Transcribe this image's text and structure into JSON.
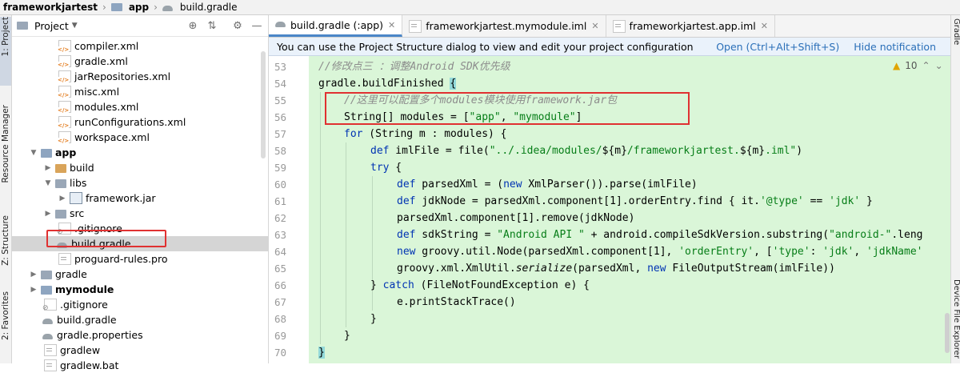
{
  "breadcrumb": [
    "frameworkjartest",
    "app",
    "build.gradle"
  ],
  "left_stripe": {
    "project_tab": "1: Project",
    "resource_tab": "Resource Manager",
    "structure_tab": "Z: Structure",
    "favorites_tab": "2: Favorites"
  },
  "project_panel": {
    "title": "Project",
    "rows": [
      {
        "label": "compiler.xml"
      },
      {
        "label": "gradle.xml"
      },
      {
        "label": "jarRepositories.xml"
      },
      {
        "label": "misc.xml"
      },
      {
        "label": "modules.xml"
      },
      {
        "label": "runConfigurations.xml"
      },
      {
        "label": "workspace.xml"
      },
      {
        "label": "app"
      },
      {
        "label": "build"
      },
      {
        "label": "libs"
      },
      {
        "label": "framework.jar"
      },
      {
        "label": "src"
      },
      {
        "label": ".gitignore"
      },
      {
        "label": "build.gradle"
      },
      {
        "label": "proguard-rules.pro"
      },
      {
        "label": "gradle"
      },
      {
        "label": "mymodule"
      },
      {
        "label": ".gitignore"
      },
      {
        "label": "build.gradle"
      },
      {
        "label": "gradle.properties"
      },
      {
        "label": "gradlew"
      },
      {
        "label": "gradlew.bat"
      }
    ]
  },
  "editor": {
    "tabs": [
      {
        "label": "build.gradle (:app)"
      },
      {
        "label": "frameworkjartest.mymodule.iml"
      },
      {
        "label": "frameworkjartest.app.iml"
      }
    ],
    "notification": {
      "message": "You can use the Project Structure dialog to view and edit your project configuration",
      "open_link": "Open (Ctrl+Alt+Shift+S)",
      "hide_link": "Hide notification"
    },
    "warning_count": "10",
    "line_numbers": [
      "53",
      "54",
      "55",
      "56",
      "57",
      "58",
      "59",
      "60",
      "61",
      "62",
      "63",
      "64",
      "65",
      "66",
      "67",
      "68",
      "69",
      "70"
    ],
    "code": {
      "l53": "//修改点三 ：调整Android SDK优先级",
      "l54a": "gradle.buildFinished ",
      "l54b": "{",
      "l55": "//这里可以配置多个modules模块使用framework.jar包",
      "l56a": "String[] modules = [",
      "l56b": "\"app\"",
      "l56c": ", ",
      "l56d": "\"mymodule\"",
      "l56e": "]",
      "l57a": "for",
      "l57b": " (String m : modules) {",
      "l58a": "def",
      "l58b": " imlFile = file(",
      "l58c": "\"../.idea/modules/",
      "l58d": "${m}",
      "l58e": "/frameworkjartest.",
      "l58f": "${m}",
      "l58g": ".iml\"",
      "l58h": ")",
      "l59a": "try",
      "l59b": " {",
      "l60a": "def",
      "l60b": " parsedXml = (",
      "l60c": "new",
      "l60d": " XmlParser()).parse(imlFile)",
      "l61a": "def",
      "l61b": " jdkNode = parsedXml.component[1].orderEntry.find { it.",
      "l61c": "'@type'",
      "l61d": " == ",
      "l61e": "'jdk'",
      "l61f": " }",
      "l62": "parsedXml.component[1].remove(jdkNode)",
      "l63a": "def",
      "l63b": " sdkString = ",
      "l63c": "\"Android API \"",
      "l63d": " + android.compileSdkVersion.substring(",
      "l63e": "\"android-\"",
      "l63f": ".leng",
      "l64a": "new",
      "l64b": " groovy.util.Node(parsedXml.component[1], ",
      "l64c": "'orderEntry'",
      "l64d": ", [",
      "l64e": "'type'",
      "l64f": ": ",
      "l64g": "'jdk'",
      "l64h": ", ",
      "l64i": "'jdkName'",
      "l65a": "groovy.xml.XmlUtil.",
      "l65b": "serialize",
      "l65c": "(parsedXml, ",
      "l65d": "new",
      "l65e": " FileOutputStream(imlFile))",
      "l66a": "} ",
      "l66b": "catch",
      "l66c": " (FileNotFoundException e) {",
      "l67": "e.printStackTrace()",
      "l68": "}",
      "l69": "}",
      "l70": "}"
    }
  },
  "right_stripe": {
    "gradle_tab": "Gradle",
    "device_tab": "Device File Explorer"
  }
}
